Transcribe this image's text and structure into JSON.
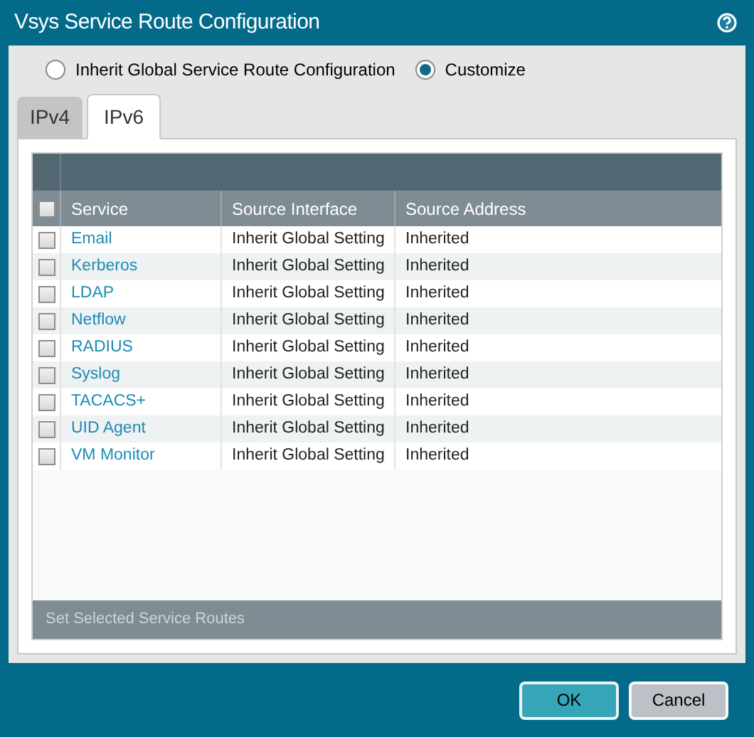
{
  "window": {
    "title": "Vsys Service Route Configuration"
  },
  "mode_options": [
    {
      "label": "Inherit Global Service Route Configuration",
      "selected": false
    },
    {
      "label": "Customize",
      "selected": true
    }
  ],
  "tabs": [
    {
      "label": "IPv4",
      "selected": false
    },
    {
      "label": "IPv6",
      "selected": true
    }
  ],
  "table": {
    "select_all_checked": false,
    "columns": [
      "Service",
      "Source Interface",
      "Source Address"
    ],
    "rows": [
      {
        "checked": false,
        "service": "Email",
        "source_interface": "Inherit Global Setting",
        "source_address": "Inherited"
      },
      {
        "checked": false,
        "service": "Kerberos",
        "source_interface": "Inherit Global Setting",
        "source_address": "Inherited"
      },
      {
        "checked": false,
        "service": "LDAP",
        "source_interface": "Inherit Global Setting",
        "source_address": "Inherited"
      },
      {
        "checked": false,
        "service": "Netflow",
        "source_interface": "Inherit Global Setting",
        "source_address": "Inherited"
      },
      {
        "checked": false,
        "service": "RADIUS",
        "source_interface": "Inherit Global Setting",
        "source_address": "Inherited"
      },
      {
        "checked": false,
        "service": "Syslog",
        "source_interface": "Inherit Global Setting",
        "source_address": "Inherited"
      },
      {
        "checked": false,
        "service": "TACACS+",
        "source_interface": "Inherit Global Setting",
        "source_address": "Inherited"
      },
      {
        "checked": false,
        "service": "UID Agent",
        "source_interface": "Inherit Global Setting",
        "source_address": "Inherited"
      },
      {
        "checked": false,
        "service": "VM Monitor",
        "source_interface": "Inherit Global Setting",
        "source_address": "Inherited"
      }
    ],
    "footer_action": {
      "label": "Set Selected Service Routes",
      "disabled": true
    }
  },
  "buttons": [
    {
      "label": "OK",
      "kind": "primary"
    },
    {
      "label": "Cancel",
      "kind": "secondary"
    }
  ]
}
